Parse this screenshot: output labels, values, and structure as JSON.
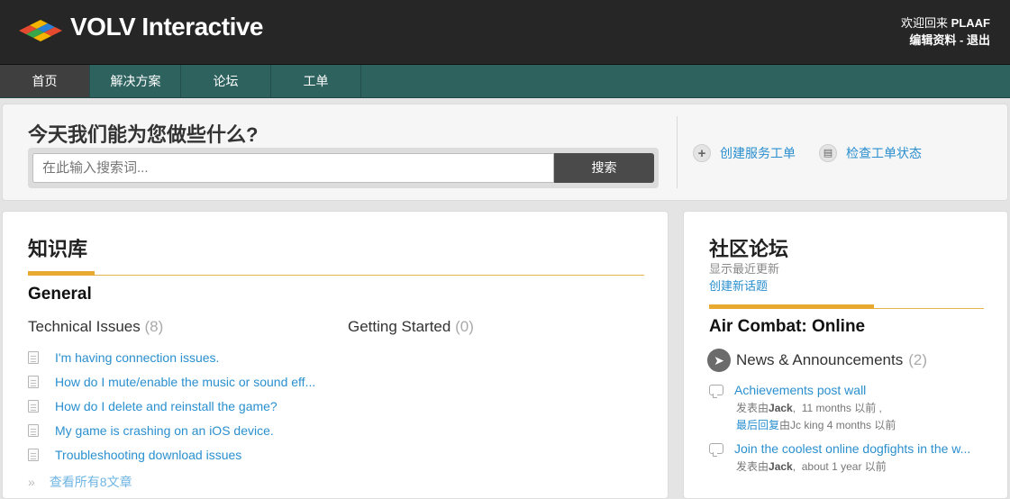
{
  "header": {
    "brand": "VOLV Interactive",
    "welcome_prefix": "欢迎回来",
    "username": "PLAAF",
    "edit_profile": "编辑资料",
    "separator": " - ",
    "logout": "退出",
    "logo_colors": [
      "#e64a2e",
      "#f5b400",
      "#3aa64a",
      "#2a7fd6"
    ]
  },
  "nav": {
    "items": [
      {
        "label": "首页",
        "active": true
      },
      {
        "label": "解决方案",
        "active": false
      },
      {
        "label": "论坛",
        "active": false
      },
      {
        "label": "工单",
        "active": false
      }
    ]
  },
  "search": {
    "title": "今天我们能为您做些什么?",
    "placeholder": "在此输入搜索词...",
    "button": "搜索",
    "actions": [
      {
        "icon": "plus-icon",
        "label": "创建服务工单"
      },
      {
        "icon": "document-icon",
        "label": "检查工单状态"
      }
    ]
  },
  "knowledge_base": {
    "title": "知识库",
    "section": "General",
    "categories": [
      {
        "name": "Technical Issues",
        "count": "(8)"
      },
      {
        "name": "Getting Started",
        "count": "(0)"
      }
    ],
    "articles": [
      "I'm having connection issues.",
      "How do I mute/enable the music or sound eff...",
      "How do I delete and reinstall the game?",
      "My game is crashing on an iOS device.",
      "Troubleshooting download issues"
    ],
    "see_all": "查看所有8文章",
    "see_all_arrow": "»"
  },
  "forum": {
    "title": "社区论坛",
    "subtitle": "显示最近更新",
    "new_topic": "创建新话题",
    "section": "Air Combat: Online",
    "category": {
      "name": "News & Announcements",
      "count": "(2)"
    },
    "topics": [
      {
        "title": "Achievements post wall",
        "posted_by_prefix": "发表由",
        "author": "Jack",
        "time": "11 months 以前 ,",
        "last_reply_label": "最后回复",
        "last_reply_rest": "由Jc king 4 months 以前"
      },
      {
        "title": "Join the coolest online dogfights in the w...",
        "posted_by_prefix": "发表由",
        "author": "Jack",
        "time": "about 1 year 以前"
      }
    ]
  },
  "colors": {
    "header_bg": "#262626",
    "nav_bg": "#2e625f",
    "link": "#2a8fcf",
    "accent": "#e8a930"
  }
}
